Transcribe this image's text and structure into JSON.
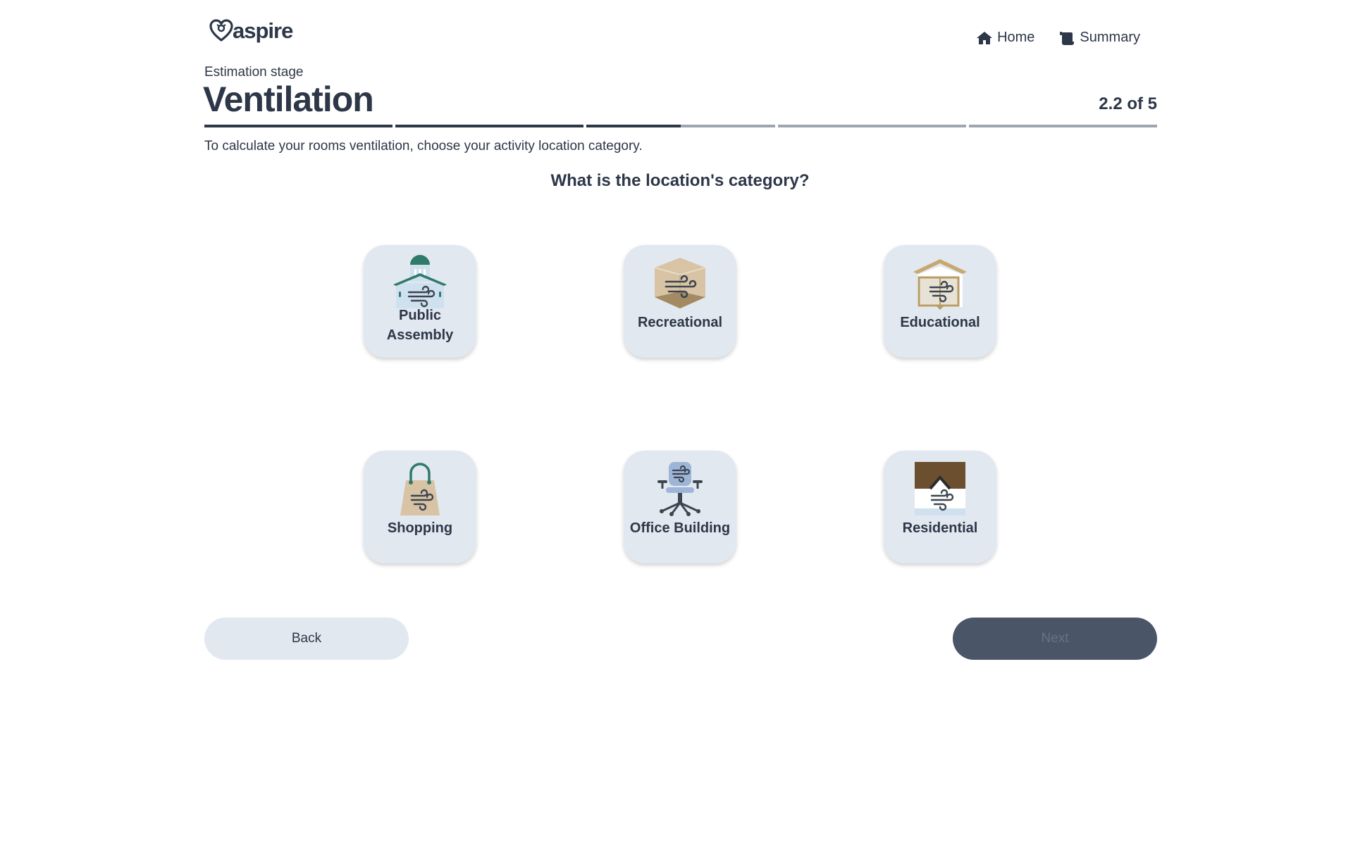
{
  "app": {
    "logo_text": "aspire"
  },
  "nav": {
    "home_label": "Home",
    "summary_label": "Summary"
  },
  "header": {
    "stage_label": "Estimation stage",
    "title": "Ventilation",
    "step_counter": "2.2 of 5",
    "progress_fractions": [
      1,
      1,
      0.5,
      0,
      0
    ]
  },
  "instruction": "To calculate your rooms ventilation, choose your activity location category.",
  "question": "What is the location's category?",
  "categories": [
    {
      "label_line1": "Public",
      "label_line2": "Assembly",
      "icon": "public-assembly-icon"
    },
    {
      "label": "Recreational",
      "icon": "recreational-icon"
    },
    {
      "label": "Educational",
      "icon": "educational-icon"
    },
    {
      "label": "Shopping",
      "icon": "shopping-bag-icon"
    },
    {
      "label": "Office Building",
      "icon": "office-chair-icon"
    },
    {
      "label": "Residential",
      "icon": "residential-icon"
    }
  ],
  "buttons": {
    "back_label": "Back",
    "next_label": "Next"
  },
  "colors": {
    "text": "#2d3748",
    "tile_bg": "#e2e8f0",
    "progress_done": "#2d3748",
    "progress_todo": "#a0a6b0",
    "next_bg": "#4a5568",
    "teal": "#2f7a6b",
    "tan": "#d8c4a4",
    "brown": "#6b4f2e"
  }
}
